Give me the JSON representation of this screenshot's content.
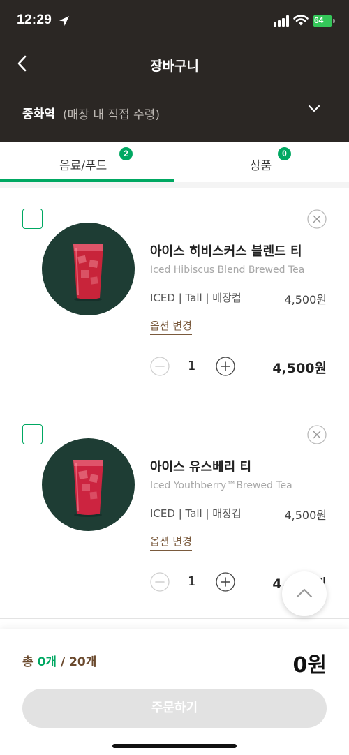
{
  "status_bar": {
    "time": "12:29",
    "battery": "64"
  },
  "nav": {
    "title": "장바구니"
  },
  "store": {
    "name": "중화역",
    "type": "(매장 내 직접 수령)"
  },
  "tabs": [
    {
      "label": "음료/푸드",
      "badge": "2",
      "active": true
    },
    {
      "label": "상품",
      "badge": "0",
      "active": false
    }
  ],
  "cart_items": [
    {
      "name": "아이스 히비스커스 블렌드 티",
      "name_en": "Iced Hibiscus Blend Brewed Tea",
      "options": "ICED | Tall | 매장컵",
      "unit_price": "4,500원",
      "option_link": "옵션 변경",
      "quantity": "1",
      "total": "4,500원",
      "checked": false
    },
    {
      "name": "아이스 유스베리 티",
      "name_en": "Iced Youthberry™Brewed Tea",
      "options": "ICED | Tall | 매장컵",
      "unit_price": "4,500원",
      "option_link": "옵션 변경",
      "quantity": "1",
      "total": "4,500원",
      "checked": false
    }
  ],
  "order": {
    "count_prefix": "총 ",
    "count_selected": "0개",
    "count_suffix": " / 20개",
    "total": "0원",
    "button_label": "주문하기"
  },
  "colors": {
    "header_bg": "#2b2724",
    "accent_green": "#00a862",
    "brown_text": "#6b4a2e",
    "disabled_button": "#e2e2e2"
  },
  "icons": {
    "back": "chevron-left-icon",
    "store_toggle": "chevron-down-icon",
    "remove": "close-circle-icon",
    "minus": "minus-circle-icon",
    "plus": "plus-circle-icon",
    "scroll_top": "chevron-up-icon"
  }
}
